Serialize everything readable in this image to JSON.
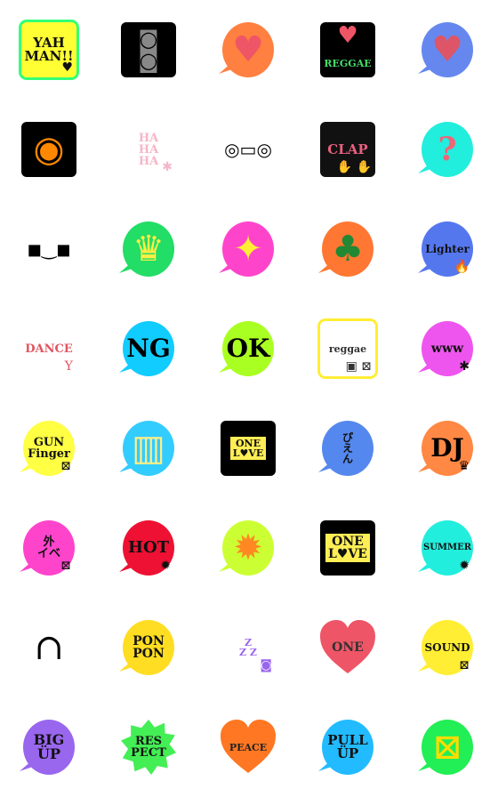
{
  "stickers": [
    {
      "label": "YAH\nMAN!!",
      "shape": "square",
      "bg": "#ffff33",
      "border": "#33ff77",
      "fg": "#111111",
      "size": 15,
      "icon": "heart-sunglasses-icon"
    },
    {
      "label": "",
      "shape": "square",
      "bg": "#000000",
      "fg": "#888888",
      "icon": "speaker-icon"
    },
    {
      "label": "",
      "shape": "bubble",
      "bg": "#ff8040",
      "fg": "#ee5566",
      "icon": "heart-icon"
    },
    {
      "label": "REGGAE",
      "shape": "square",
      "bg": "#000000",
      "fg": "#44dd66",
      "size": 11,
      "icon": "heart-icon",
      "iconColor": "#ee5566"
    },
    {
      "label": "",
      "shape": "bubble",
      "bg": "#6688ee",
      "fg": "#dd5566",
      "icon": "heart-icon"
    },
    {
      "label": "",
      "shape": "square",
      "bg": "#000000",
      "fg": "#ff8800",
      "icon": "speaker-cone-icon"
    },
    {
      "label": "HA\nHA\nHA",
      "shape": "none",
      "bg": "",
      "fg": "#f4b6c8",
      "size": 13,
      "icon": "leaf-icon"
    },
    {
      "label": "",
      "shape": "none",
      "bg": "",
      "fg": "#000000",
      "icon": "boombox-icon"
    },
    {
      "label": "CLAP",
      "shape": "square",
      "bg": "#111111",
      "fg": "#e86080",
      "size": 15,
      "icon": "hands-icon"
    },
    {
      "label": "?",
      "shape": "bubble",
      "bg": "#22eedd",
      "fg": "#ee6677",
      "size": 36,
      "icon": "question-icon"
    },
    {
      "label": "",
      "shape": "none",
      "bg": "",
      "fg": "#000000",
      "icon": "sunglasses-icon"
    },
    {
      "label": "",
      "shape": "bubble",
      "bg": "#22dd66",
      "fg": "#ffee44",
      "icon": "crown-icon"
    },
    {
      "label": "",
      "shape": "bubble",
      "bg": "#ff44cc",
      "fg": "#ffee33",
      "icon": "sparkle-icon"
    },
    {
      "label": "",
      "shape": "bubble",
      "bg": "#ff7733",
      "fg": "#228833",
      "icon": "palm-tree-icon"
    },
    {
      "label": "Lighter",
      "shape": "bubble",
      "bg": "#5577ee",
      "fg": "#111111",
      "size": 12,
      "icon": "flame-icon"
    },
    {
      "label": "DANCE",
      "shape": "none",
      "bg": "",
      "fg": "#e05560",
      "size": 13,
      "icon": "dancer-icon"
    },
    {
      "label": "NG",
      "shape": "bubble",
      "bg": "#11ccff",
      "fg": "#000000",
      "size": 28,
      "icon": ""
    },
    {
      "label": "OK",
      "shape": "bubble",
      "bg": "#aaff22",
      "fg": "#000000",
      "size": 28,
      "icon": ""
    },
    {
      "label": "reggae",
      "shape": "square",
      "bg": "#ffffff",
      "border": "#ffee33",
      "fg": "#333333",
      "size": 11,
      "icon": "speaker-flag-icon"
    },
    {
      "label": "www",
      "shape": "bubble",
      "bg": "#ee55ee",
      "fg": "#111111",
      "size": 14,
      "icon": "leaf-icon"
    },
    {
      "label": "GUN\nFinger",
      "shape": "bubble",
      "bg": "#ffff44",
      "fg": "#111111",
      "size": 13,
      "icon": "jamaica-flag-icon"
    },
    {
      "label": "",
      "shape": "bubble",
      "bg": "#33ccff",
      "fg": "#ffee88",
      "icon": "beer-icon"
    },
    {
      "label": "ONE\nL♥VE",
      "shape": "square",
      "bg": "#000000",
      "fg": "#111111",
      "size": 11,
      "icon": "mug-icon"
    },
    {
      "label": "ぴ\nえ\nん",
      "shape": "bubble",
      "bg": "#5588ee",
      "fg": "#111111",
      "size": 12,
      "icon": ""
    },
    {
      "label": "DJ",
      "shape": "bubble",
      "bg": "#ff8844",
      "fg": "#000000",
      "size": 28,
      "icon": "crown-icon"
    },
    {
      "label": "外\nイベ",
      "shape": "bubble",
      "bg": "#ff44cc",
      "fg": "#111111",
      "size": 13,
      "icon": "jamaica-flag-icon"
    },
    {
      "label": "HOT",
      "shape": "bubble",
      "bg": "#ee1133",
      "fg": "#111111",
      "size": 18,
      "icon": "sun-icon"
    },
    {
      "label": "",
      "shape": "bubble",
      "bg": "#ccff33",
      "fg": "#ff8822",
      "icon": "sun-icon"
    },
    {
      "label": "ONE\nL♥VE",
      "shape": "square",
      "bg": "#000000",
      "fg": "#111111",
      "size": 14,
      "icon": ""
    },
    {
      "label": "SUMMER",
      "shape": "bubble",
      "bg": "#22eedd",
      "fg": "#111111",
      "size": 10,
      "icon": "sun-icon"
    },
    {
      "label": "",
      "shape": "none",
      "bg": "",
      "fg": "#000000",
      "icon": "headphones-icon"
    },
    {
      "label": "PON\nPON",
      "shape": "bubble",
      "bg": "#ffdd22",
      "fg": "#111111",
      "size": 14,
      "icon": ""
    },
    {
      "label": "Z\nZ Z",
      "shape": "none",
      "bg": "",
      "fg": "#9966ee",
      "size": 11,
      "icon": "speaker-icon"
    },
    {
      "label": "ONE",
      "shape": "heart",
      "bg": "#ee5566",
      "fg": "#333333",
      "size": 14,
      "icon": ""
    },
    {
      "label": "SOUND",
      "shape": "bubble",
      "bg": "#ffee33",
      "fg": "#111111",
      "size": 12,
      "icon": "jamaica-flag-icon"
    },
    {
      "label": "BIG\nÜP",
      "shape": "bubble",
      "bg": "#9966ee",
      "fg": "#111111",
      "size": 16,
      "icon": ""
    },
    {
      "label": "RES\nPECT",
      "shape": "star",
      "bg": "#44ee55",
      "fg": "#111111",
      "size": 13,
      "icon": ""
    },
    {
      "label": "PEACE",
      "shape": "heart",
      "bg": "#ff7722",
      "fg": "#222222",
      "size": 11,
      "icon": ""
    },
    {
      "label": "PULL\nÜP",
      "shape": "bubble",
      "bg": "#22bbff",
      "fg": "#111111",
      "size": 15,
      "icon": ""
    },
    {
      "label": "",
      "shape": "bubble",
      "bg": "#22ee55",
      "fg": "#ffdd00",
      "icon": "jamaica-flag-icon"
    }
  ]
}
